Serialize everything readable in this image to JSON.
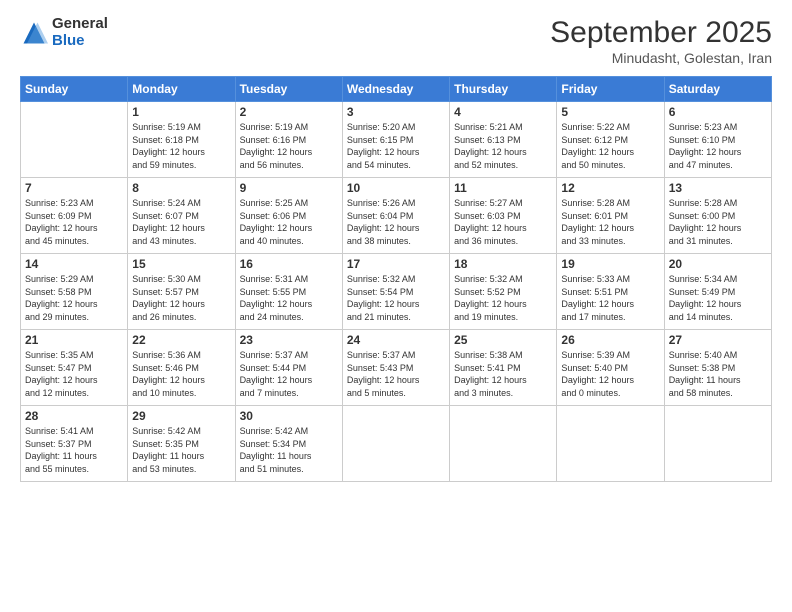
{
  "logo": {
    "general": "General",
    "blue": "Blue"
  },
  "header": {
    "title": "September 2025",
    "subtitle": "Minudasht, Golestan, Iran"
  },
  "weekdays": [
    "Sunday",
    "Monday",
    "Tuesday",
    "Wednesday",
    "Thursday",
    "Friday",
    "Saturday"
  ],
  "weeks": [
    [
      {
        "day": "",
        "content": ""
      },
      {
        "day": "1",
        "content": "Sunrise: 5:19 AM\nSunset: 6:18 PM\nDaylight: 12 hours\nand 59 minutes."
      },
      {
        "day": "2",
        "content": "Sunrise: 5:19 AM\nSunset: 6:16 PM\nDaylight: 12 hours\nand 56 minutes."
      },
      {
        "day": "3",
        "content": "Sunrise: 5:20 AM\nSunset: 6:15 PM\nDaylight: 12 hours\nand 54 minutes."
      },
      {
        "day": "4",
        "content": "Sunrise: 5:21 AM\nSunset: 6:13 PM\nDaylight: 12 hours\nand 52 minutes."
      },
      {
        "day": "5",
        "content": "Sunrise: 5:22 AM\nSunset: 6:12 PM\nDaylight: 12 hours\nand 50 minutes."
      },
      {
        "day": "6",
        "content": "Sunrise: 5:23 AM\nSunset: 6:10 PM\nDaylight: 12 hours\nand 47 minutes."
      }
    ],
    [
      {
        "day": "7",
        "content": "Sunrise: 5:23 AM\nSunset: 6:09 PM\nDaylight: 12 hours\nand 45 minutes."
      },
      {
        "day": "8",
        "content": "Sunrise: 5:24 AM\nSunset: 6:07 PM\nDaylight: 12 hours\nand 43 minutes."
      },
      {
        "day": "9",
        "content": "Sunrise: 5:25 AM\nSunset: 6:06 PM\nDaylight: 12 hours\nand 40 minutes."
      },
      {
        "day": "10",
        "content": "Sunrise: 5:26 AM\nSunset: 6:04 PM\nDaylight: 12 hours\nand 38 minutes."
      },
      {
        "day": "11",
        "content": "Sunrise: 5:27 AM\nSunset: 6:03 PM\nDaylight: 12 hours\nand 36 minutes."
      },
      {
        "day": "12",
        "content": "Sunrise: 5:28 AM\nSunset: 6:01 PM\nDaylight: 12 hours\nand 33 minutes."
      },
      {
        "day": "13",
        "content": "Sunrise: 5:28 AM\nSunset: 6:00 PM\nDaylight: 12 hours\nand 31 minutes."
      }
    ],
    [
      {
        "day": "14",
        "content": "Sunrise: 5:29 AM\nSunset: 5:58 PM\nDaylight: 12 hours\nand 29 minutes."
      },
      {
        "day": "15",
        "content": "Sunrise: 5:30 AM\nSunset: 5:57 PM\nDaylight: 12 hours\nand 26 minutes."
      },
      {
        "day": "16",
        "content": "Sunrise: 5:31 AM\nSunset: 5:55 PM\nDaylight: 12 hours\nand 24 minutes."
      },
      {
        "day": "17",
        "content": "Sunrise: 5:32 AM\nSunset: 5:54 PM\nDaylight: 12 hours\nand 21 minutes."
      },
      {
        "day": "18",
        "content": "Sunrise: 5:32 AM\nSunset: 5:52 PM\nDaylight: 12 hours\nand 19 minutes."
      },
      {
        "day": "19",
        "content": "Sunrise: 5:33 AM\nSunset: 5:51 PM\nDaylight: 12 hours\nand 17 minutes."
      },
      {
        "day": "20",
        "content": "Sunrise: 5:34 AM\nSunset: 5:49 PM\nDaylight: 12 hours\nand 14 minutes."
      }
    ],
    [
      {
        "day": "21",
        "content": "Sunrise: 5:35 AM\nSunset: 5:47 PM\nDaylight: 12 hours\nand 12 minutes."
      },
      {
        "day": "22",
        "content": "Sunrise: 5:36 AM\nSunset: 5:46 PM\nDaylight: 12 hours\nand 10 minutes."
      },
      {
        "day": "23",
        "content": "Sunrise: 5:37 AM\nSunset: 5:44 PM\nDaylight: 12 hours\nand 7 minutes."
      },
      {
        "day": "24",
        "content": "Sunrise: 5:37 AM\nSunset: 5:43 PM\nDaylight: 12 hours\nand 5 minutes."
      },
      {
        "day": "25",
        "content": "Sunrise: 5:38 AM\nSunset: 5:41 PM\nDaylight: 12 hours\nand 3 minutes."
      },
      {
        "day": "26",
        "content": "Sunrise: 5:39 AM\nSunset: 5:40 PM\nDaylight: 12 hours\nand 0 minutes."
      },
      {
        "day": "27",
        "content": "Sunrise: 5:40 AM\nSunset: 5:38 PM\nDaylight: 11 hours\nand 58 minutes."
      }
    ],
    [
      {
        "day": "28",
        "content": "Sunrise: 5:41 AM\nSunset: 5:37 PM\nDaylight: 11 hours\nand 55 minutes."
      },
      {
        "day": "29",
        "content": "Sunrise: 5:42 AM\nSunset: 5:35 PM\nDaylight: 11 hours\nand 53 minutes."
      },
      {
        "day": "30",
        "content": "Sunrise: 5:42 AM\nSunset: 5:34 PM\nDaylight: 11 hours\nand 51 minutes."
      },
      {
        "day": "",
        "content": ""
      },
      {
        "day": "",
        "content": ""
      },
      {
        "day": "",
        "content": ""
      },
      {
        "day": "",
        "content": ""
      }
    ]
  ]
}
